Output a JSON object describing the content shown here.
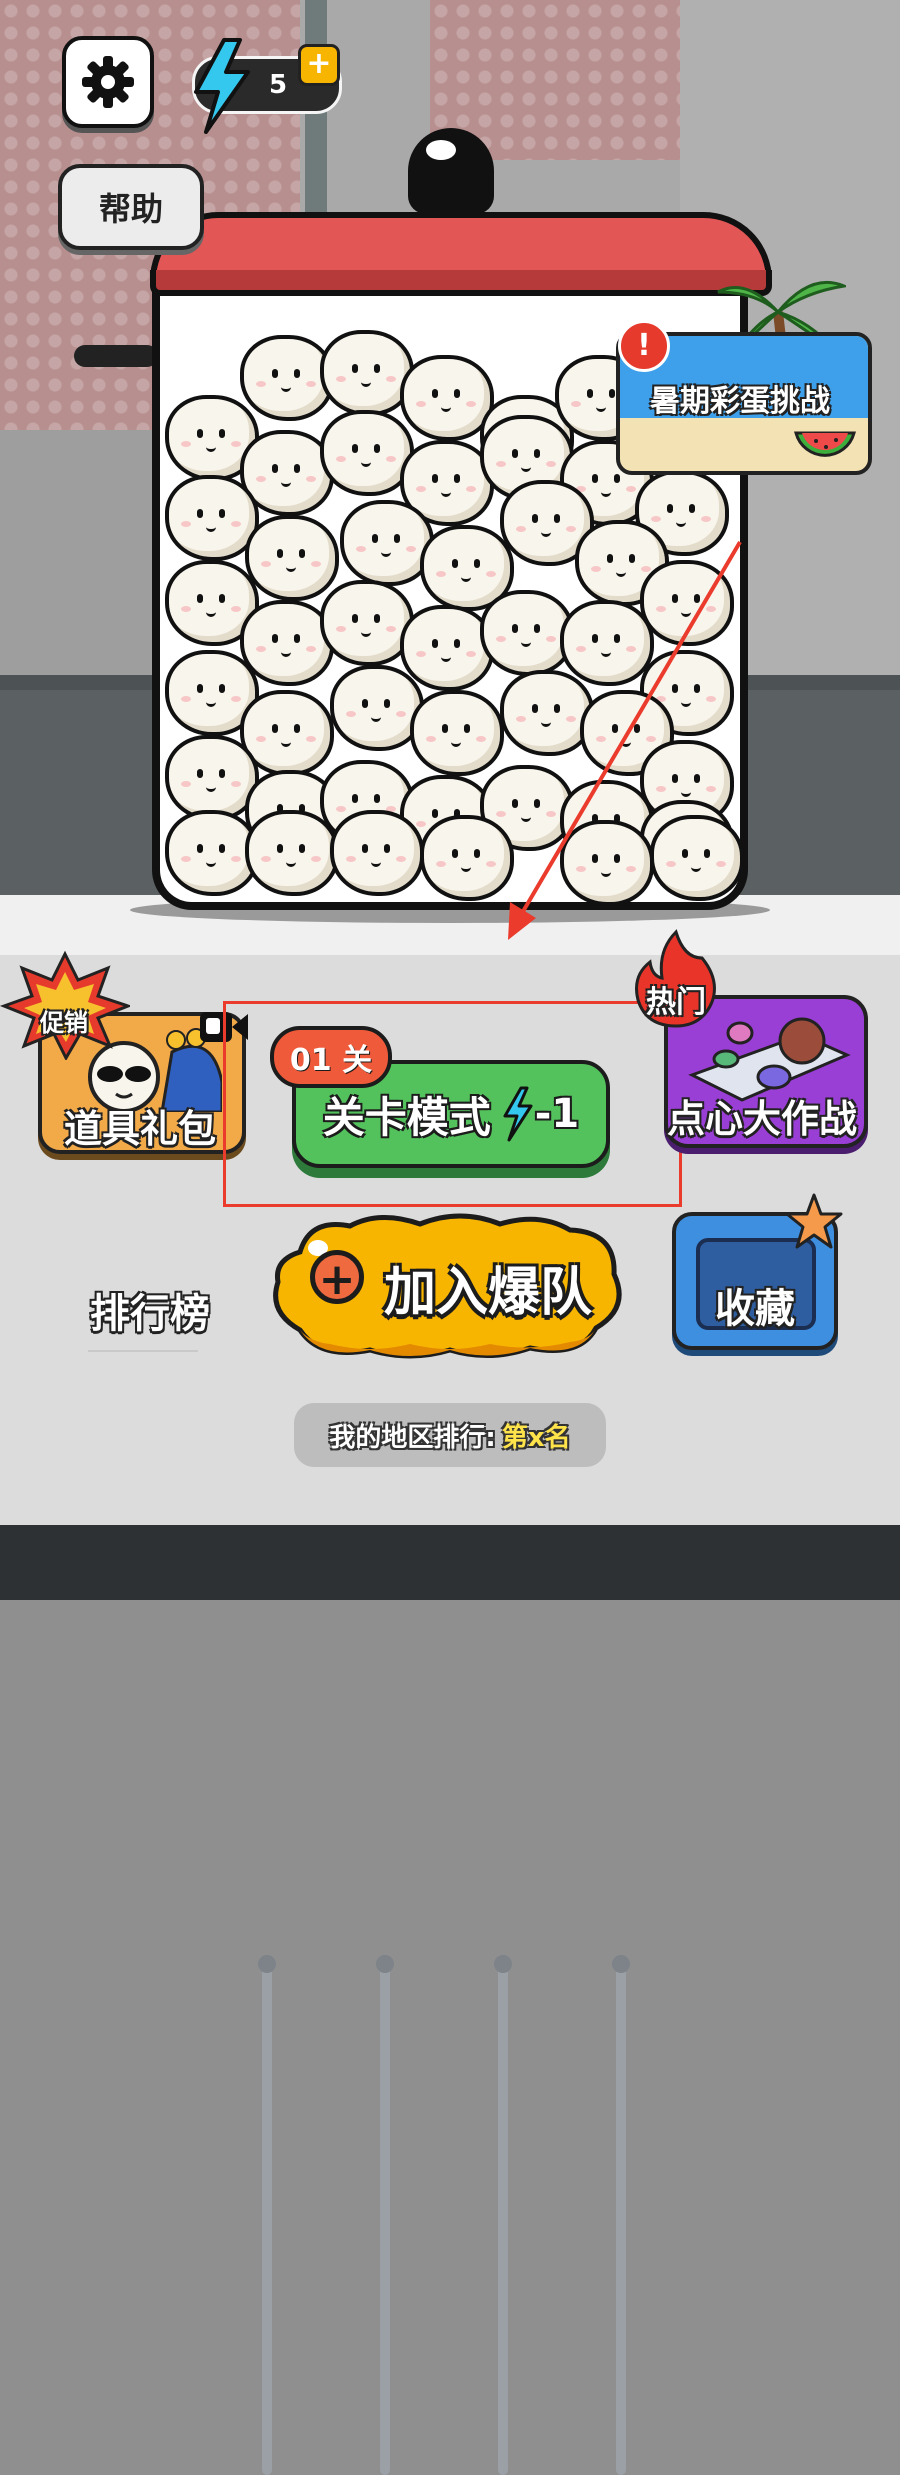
{
  "hud": {
    "energy_value": "5",
    "energy_plus": "+",
    "help_label": "帮助"
  },
  "summer_event": {
    "label": "暑期彩蛋挑战",
    "alert": "!"
  },
  "promo_pack": {
    "tag": "促销",
    "label": "道具礼包"
  },
  "level_mode": {
    "badge": "01 关",
    "label": "关卡模式",
    "cost": "-1"
  },
  "dimsum_battle": {
    "tag": "热门",
    "label": "点心大作战"
  },
  "join_team": {
    "plus": "+",
    "label": "加入爆队"
  },
  "leaderboard": {
    "label": "排行榜"
  },
  "favorites": {
    "label": "收藏"
  },
  "regional_rank": {
    "prefix": "我的地区排行:",
    "value": "第x名"
  },
  "colors": {
    "level_green": "#53c25c",
    "join_yellow": "#f7b500",
    "pot_red": "#e25656",
    "dimsum_purple": "#9a3fd6",
    "fav_blue": "#3f8fe0",
    "highlight_red": "#ea3b2c"
  },
  "icons": [
    "gear-icon",
    "lightning-icon",
    "palm-tree-icon",
    "watermelon-icon",
    "video-camera-icon",
    "flame-icon",
    "star-icon",
    "plus-circle-icon"
  ]
}
